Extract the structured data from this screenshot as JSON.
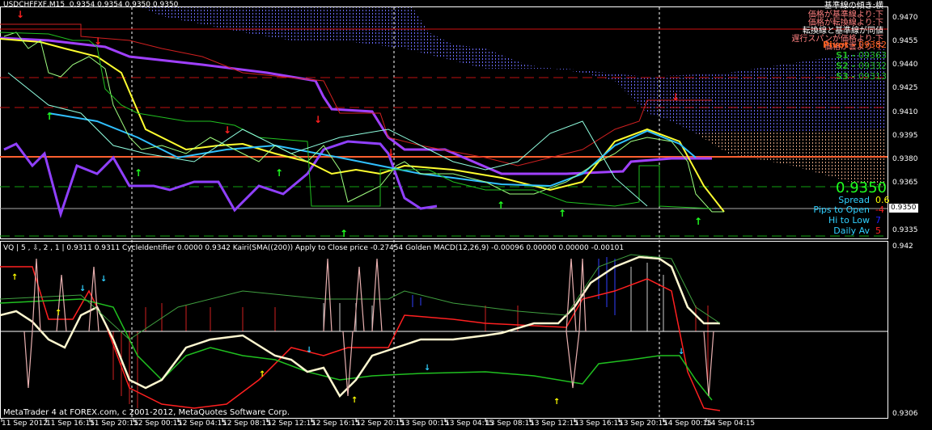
{
  "header": {
    "symbol": "USDCHFFXF,M15",
    "ohlc": "0.9354 0.9354 0.9350 0.9350"
  },
  "notes": [
    "基準線の傾き:横",
    "価格が基準線より:下",
    "価格が転換線より:下",
    "転換線と基準線が同値",
    "遅行スパンが価格より:下",
    "価格が雲より:下"
  ],
  "pivots": [
    {
      "label": "Pivot -",
      "value": "09382"
    },
    {
      "label": "S1 -",
      "value": "09363"
    },
    {
      "label": "S2 -",
      "value": "09332"
    },
    {
      "label": "S3 -",
      "value": "09313"
    }
  ],
  "stats": {
    "price": "0.9350",
    "rows": [
      {
        "label": "Spread",
        "value": "0.6",
        "color": "#ffff00"
      },
      {
        "label": "Pips to Open",
        "value": "-4",
        "color": "#ff0000"
      },
      {
        "label": "Hi to Low",
        "value": "7",
        "color": "#0000ff"
      },
      {
        "label": "Daily Av",
        "value": "5",
        "color": "#ff0000"
      }
    ]
  },
  "price_axis": [
    "0.9470",
    "0.9455",
    "0.9440",
    "0.9425",
    "0.9410",
    "0.9395",
    "0.9380",
    "0.9365",
    "0.9335"
  ],
  "current_price": "0.9350",
  "indicator": {
    "header": "VQ | 5 , ⇩, 2 , 1  |  0.9311 0.9311  CycleIdentifier 0.0000 0.9342  Kairi(SMA((200)) Apply to Close price -0.27454  Golden MACD(12,26,9) -0.00096 0.00000 0.00000 -0.00101",
    "axis_top": "0.942",
    "axis_bottom": "0.9306"
  },
  "copyright": "MetaTrader 4 at FOREX.com, c 2001-2012, MetaQuotes Software Corp.",
  "time_axis": [
    "11 Sep 2012",
    "11 Sep 16:15",
    "11 Sep 20:15",
    "12 Sep 00:15",
    "12 Sep 04:15",
    "12 Sep 08:15",
    "12 Sep 12:15",
    "12 Sep 16:15",
    "12 Sep 20:15",
    "13 Sep 00:15",
    "13 Sep 04:15",
    "13 Sep 08:15",
    "13 Sep 12:15",
    "13 Sep 16:15",
    "13 Sep 20:15",
    "14 Sep 00:15",
    "14 Sep 04:15"
  ]
}
